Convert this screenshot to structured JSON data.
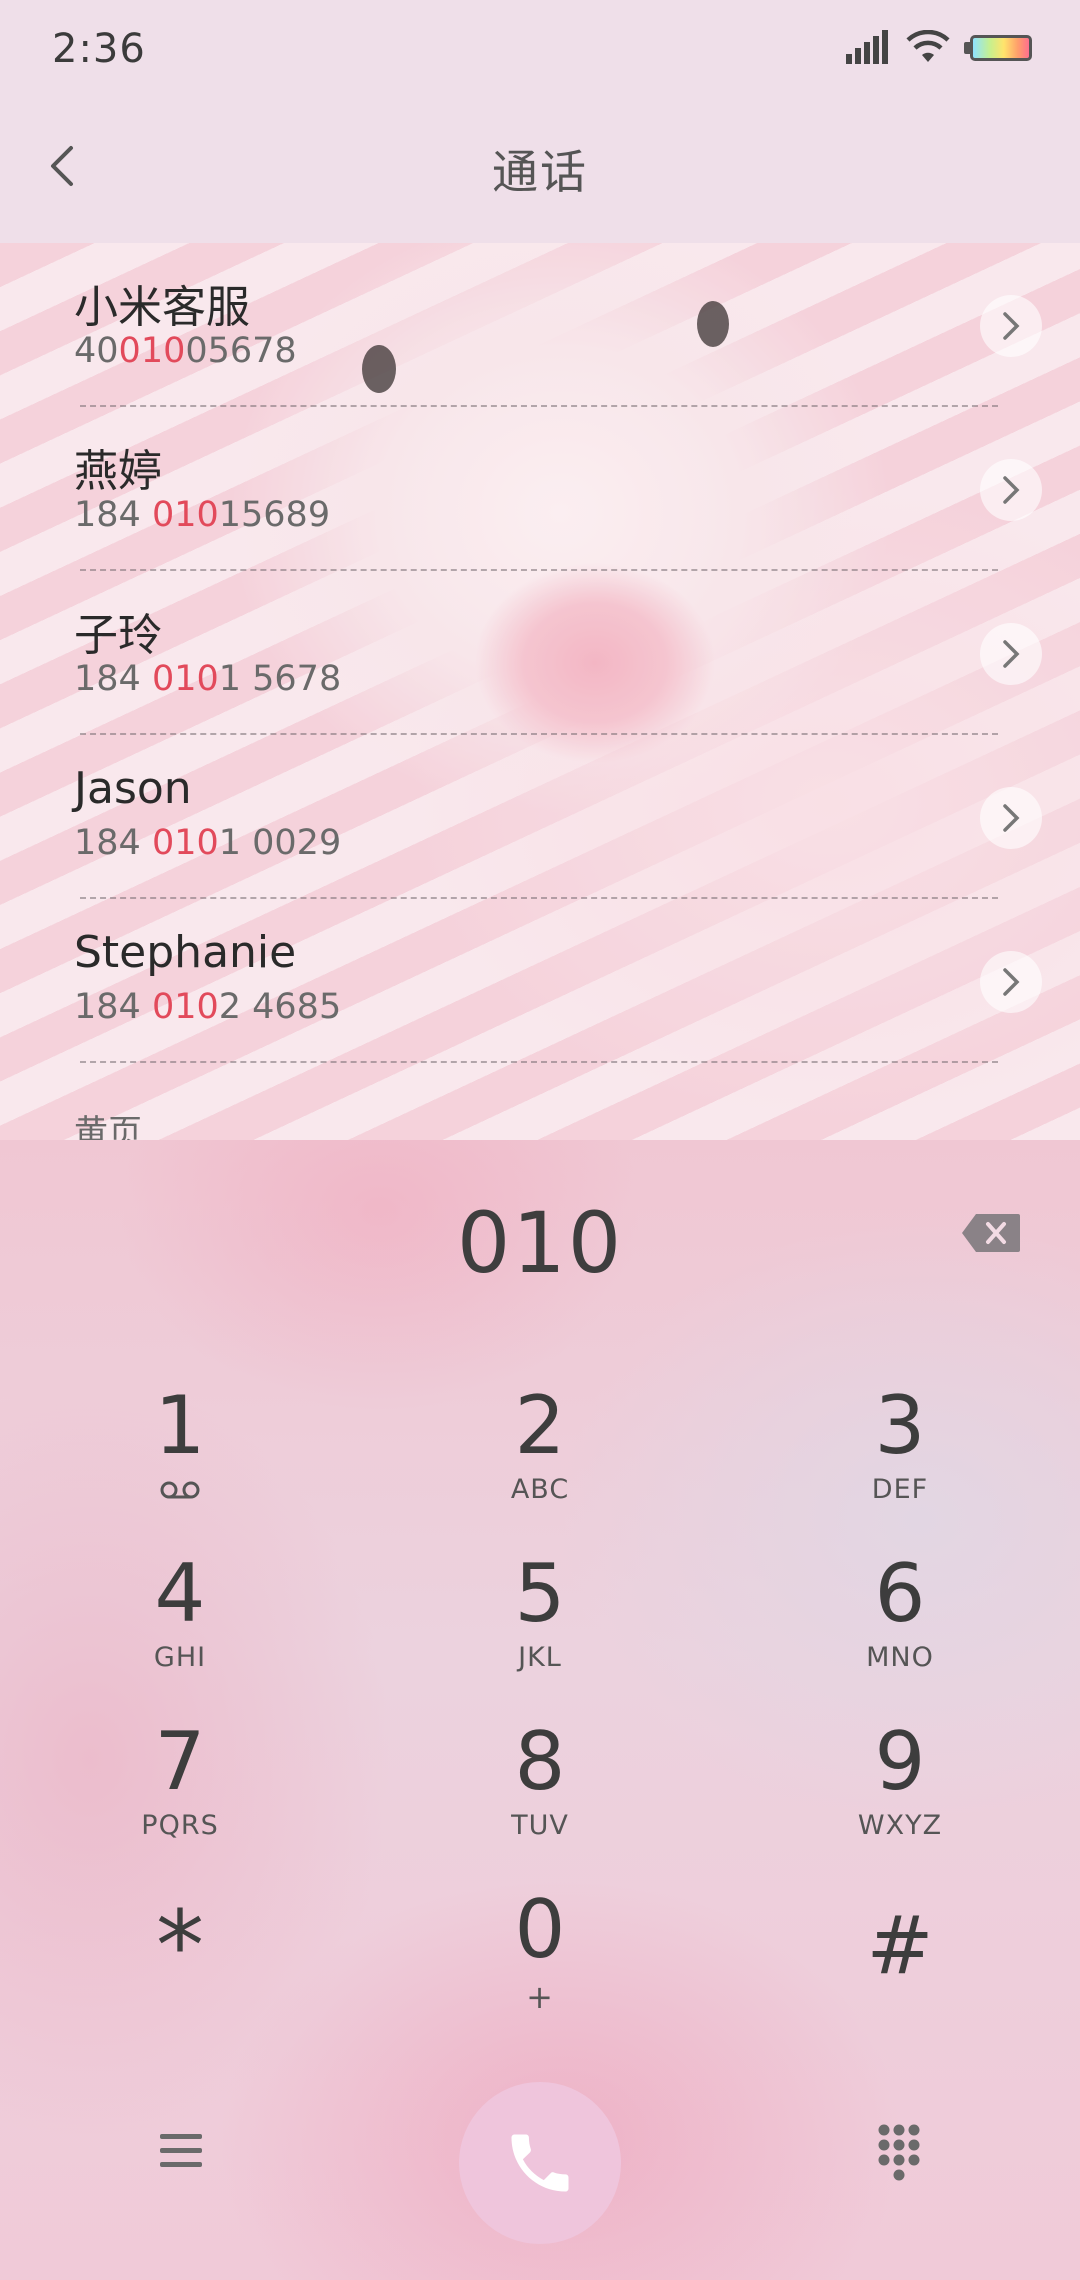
{
  "status_bar": {
    "time": "2:36"
  },
  "header": {
    "title": "通话"
  },
  "results": [
    {
      "name": "小米客服",
      "number_parts": [
        "40",
        "010",
        "05678"
      ]
    },
    {
      "name": "燕婷",
      "number_parts": [
        "184 ",
        "010",
        "15689"
      ]
    },
    {
      "name": "子玲",
      "number_parts": [
        "184 ",
        "010",
        "1 5678"
      ]
    },
    {
      "name": "Jason",
      "number_parts": [
        "184 ",
        "010",
        "1 0029"
      ]
    },
    {
      "name": "Stephanie",
      "number_parts": [
        "184 ",
        "010",
        "2 4685"
      ]
    }
  ],
  "section_label": "黄页",
  "dialer": {
    "entered_digits": "010",
    "keys": [
      {
        "digit": "1",
        "letters": "",
        "icon": "voicemail-icon"
      },
      {
        "digit": "2",
        "letters": "ABC"
      },
      {
        "digit": "3",
        "letters": "DEF"
      },
      {
        "digit": "4",
        "letters": "GHI"
      },
      {
        "digit": "5",
        "letters": "JKL"
      },
      {
        "digit": "6",
        "letters": "MNO"
      },
      {
        "digit": "7",
        "letters": "PQRS"
      },
      {
        "digit": "8",
        "letters": "TUV"
      },
      {
        "digit": "9",
        "letters": "WXYZ"
      },
      {
        "digit": "*",
        "letters": ""
      },
      {
        "digit": "0",
        "letters": "+"
      },
      {
        "digit": "#",
        "letters": ""
      }
    ]
  },
  "colors": {
    "highlight": "#e24a5b",
    "call_button": "#efc5dc",
    "background": "#efdfe9"
  }
}
